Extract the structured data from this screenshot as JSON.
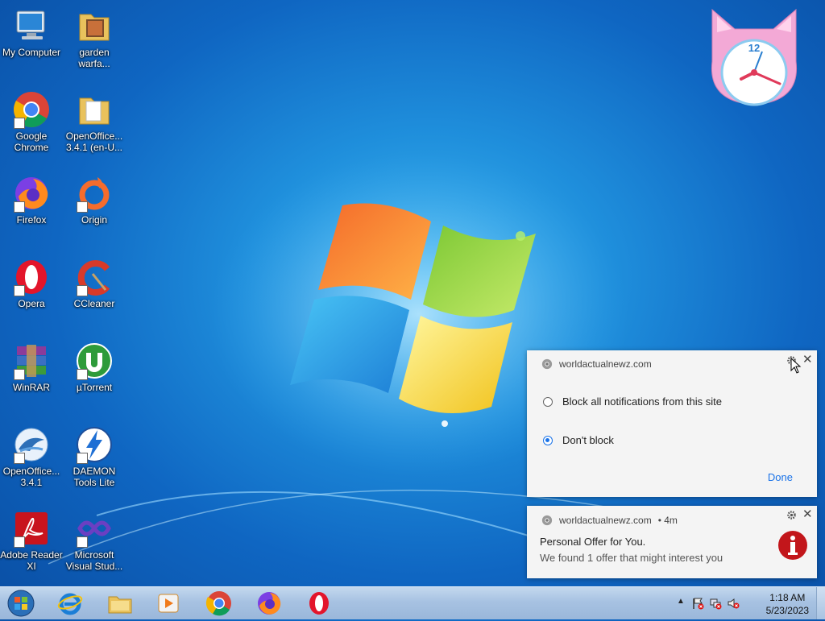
{
  "desktop_icons": [
    {
      "label": "My Computer",
      "icon": "computer-icon"
    },
    {
      "label": "garden warfa...",
      "icon": "folder-icon"
    },
    {
      "label": "Google Chrome",
      "icon": "chrome-icon"
    },
    {
      "label": "OpenOffice... 3.4.1 (en-U...",
      "icon": "folder-icon"
    },
    {
      "label": "Firefox",
      "icon": "firefox-icon"
    },
    {
      "label": "Origin",
      "icon": "origin-icon"
    },
    {
      "label": "Opera",
      "icon": "opera-icon"
    },
    {
      "label": "CCleaner",
      "icon": "ccleaner-icon"
    },
    {
      "label": "WinRAR",
      "icon": "winrar-icon"
    },
    {
      "label": "µTorrent",
      "icon": "utorrent-icon"
    },
    {
      "label": "OpenOffice... 3.4.1",
      "icon": "openoffice-icon"
    },
    {
      "label": "DAEMON Tools Lite",
      "icon": "daemon-tools-icon"
    },
    {
      "label": "Adobe Reader XI",
      "icon": "adobe-reader-icon"
    },
    {
      "label": "Microsoft Visual Stud...",
      "icon": "visual-studio-icon"
    }
  ],
  "clock_gadget": {
    "hour_label": "12"
  },
  "notification_settings": {
    "site": "worldactualnewz.com",
    "options": [
      {
        "label": "Block all notifications from this site",
        "selected": false
      },
      {
        "label": "Don't block",
        "selected": true
      }
    ],
    "done_label": "Done"
  },
  "notification": {
    "site": "worldactualnewz.com",
    "age": "• 4m",
    "title": "Personal Offer for You.",
    "body": "We found 1 offer that might interest you"
  },
  "taskbar": {
    "pinned": [
      "internet-explorer-icon",
      "file-explorer-icon",
      "media-player-icon",
      "chrome-icon",
      "firefox-icon",
      "opera-icon"
    ],
    "time": "1:18 AM",
    "date": "5/23/2023"
  },
  "colors": {
    "accent": "#1a73e8",
    "taskbar": "#a7c2e2"
  }
}
